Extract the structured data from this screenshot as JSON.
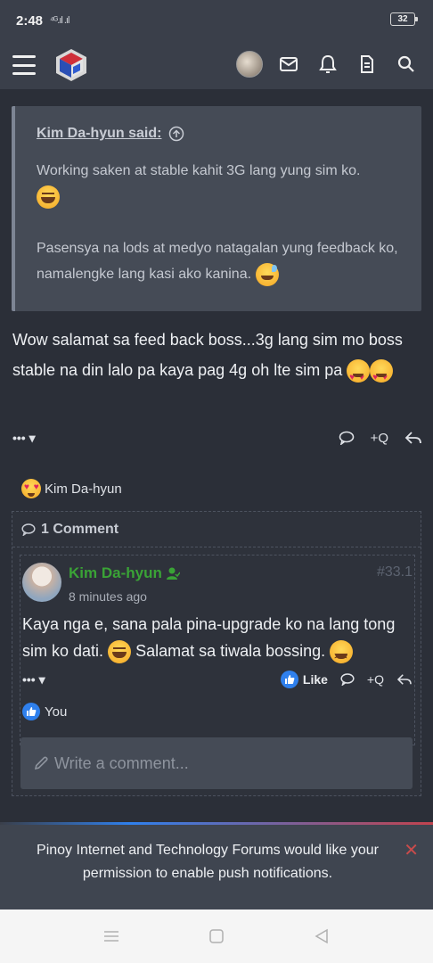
{
  "status_bar": {
    "time": "2:48",
    "signal": "⁴ᴳ.ıl .ıl",
    "battery": "32"
  },
  "quote": {
    "author": "Kim Da-hyun said:",
    "line1": "Working saken at stable kahit 3G lang yung sim ko.",
    "line2": "Pasensya na lods at medyo natagalan yung feedback ko, namalengke lang kasi ako kanina."
  },
  "post": {
    "body": "Wow salamat sa feed back boss...3g lang sim mo boss stable na din lalo pa kaya pag 4g oh lte sim pa",
    "more": "•••",
    "quote_label": "+Q"
  },
  "reaction": {
    "user": "Kim Da-hyun"
  },
  "comments": {
    "header": "1 Comment",
    "item": {
      "author": "Kim Da-hyun",
      "number": "#33.1",
      "time": "8 minutes ago",
      "text_part1": "Kaya nga e, sana pala pina-upgrade ko na lang tong sim ko dati.",
      "text_part2": "Salamat sa tiwala bossing.",
      "more": "•••",
      "like_label": "Like",
      "quote_label": "+Q",
      "reacted_by": "You"
    },
    "write_placeholder": "Write a comment..."
  },
  "notification": {
    "text": "Pinoy Internet and Technology Forums would like your permission to enable push notifications.",
    "close": "✕"
  },
  "colors": {
    "accent_green": "#3aa336",
    "like_blue": "#2f80ed",
    "background": "#2b2f38"
  }
}
